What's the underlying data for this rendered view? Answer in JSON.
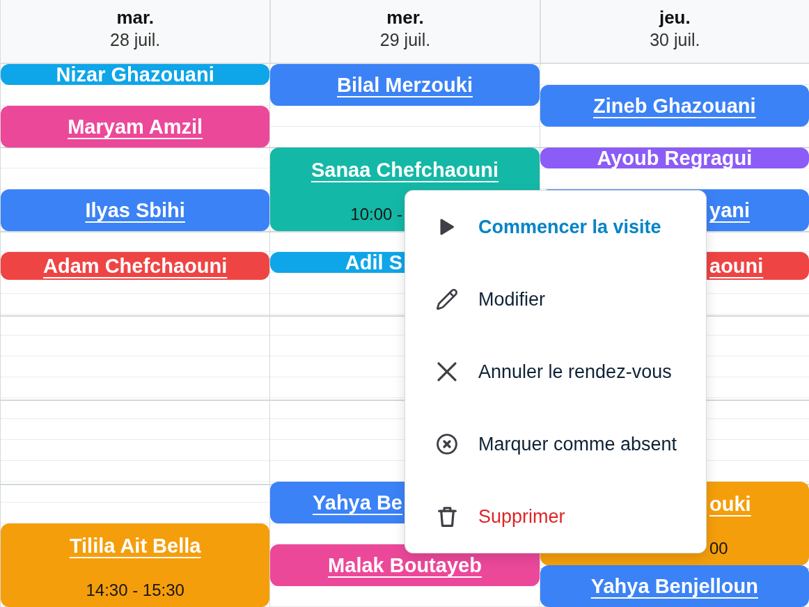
{
  "days": [
    {
      "weekday": "mar.",
      "date": "28 juil.",
      "events": [
        {
          "name": "Nizar Ghazouani",
          "color": "#0ea5e9"
        },
        {
          "name": "Maryam Amzil",
          "color": "#ec4899"
        },
        {
          "name": "Ilyas Sbihi",
          "color": "#3b82f6"
        },
        {
          "name": "Adam Chefchaouni",
          "color": "#ef4444"
        },
        {
          "name": "Tilila Ait Bella",
          "time": "14:30 - 15:30",
          "color": "#f59e0b"
        }
      ]
    },
    {
      "weekday": "mer.",
      "date": "29 juil.",
      "events": [
        {
          "name": "Bilal Merzouki",
          "color": "#3b82f6"
        },
        {
          "name": "Sanaa Chefchaouni",
          "time": "10:00 -",
          "color": "#14b8a6"
        },
        {
          "name": "Adil S",
          "color": "#0ea5e9"
        },
        {
          "name": "Yahya Be",
          "color": "#3b82f6"
        },
        {
          "name": "Malak Boutayeb",
          "color": "#ec4899"
        }
      ]
    },
    {
      "weekday": "jeu.",
      "date": "30 juil.",
      "events": [
        {
          "name": "Zineb Ghazouani",
          "color": "#3b82f6"
        },
        {
          "name": "Ayoub Regragui",
          "color": "#8b5cf6"
        },
        {
          "name": "yani",
          "color": "#3b82f6"
        },
        {
          "name": "aouni",
          "color": "#ef4444"
        },
        {
          "name": "ouki",
          "time": "00",
          "color": "#f59e0b"
        },
        {
          "name": "Yahya Benjelloun",
          "color": "#3b82f6"
        }
      ]
    }
  ],
  "context_menu": {
    "items": [
      {
        "label": "Commencer la visite",
        "kind": "start"
      },
      {
        "label": "Modifier",
        "kind": "edit"
      },
      {
        "label": "Annuler le rendez-vous",
        "kind": "cancel"
      },
      {
        "label": "Marquer comme absent",
        "kind": "absent"
      },
      {
        "label": "Supprimer",
        "kind": "delete"
      }
    ]
  }
}
